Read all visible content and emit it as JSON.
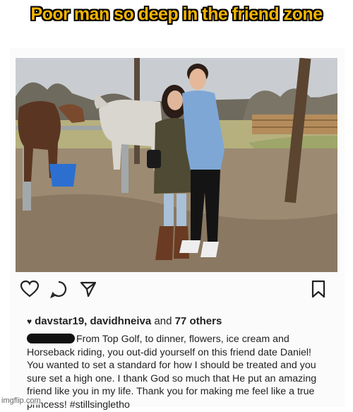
{
  "meme": {
    "title": "Poor man so deep in the friend zone",
    "watermark": "imgflip.com"
  },
  "post": {
    "likes_users": "davstar19, davidhneiva",
    "likes_and": " and ",
    "likes_others": "77 others",
    "caption": "From Top Golf, to dinner, flowers, ice cream and Horseback riding, you out-did yourself on this friend date Daniel! You wanted to set a standard for how I should be treated and you sure set a high one. I thank God so much that He put an amazing friend like you in my life. Thank you for making me feel like a true princess! #stillsingletho",
    "icons": [
      "heart-icon",
      "comment-icon",
      "share-icon",
      "bookmark-icon"
    ]
  },
  "colors": {
    "title_fill": "#f4b400",
    "title_outline": "#000000",
    "text": "#222222"
  }
}
